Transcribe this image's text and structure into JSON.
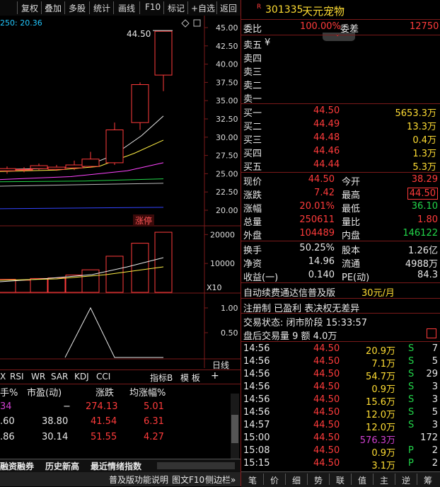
{
  "toolbar": {
    "buttons": [
      "复权",
      "叠加",
      "多股",
      "统计",
      "画线",
      "F10",
      "标记",
      "+自选",
      "返回"
    ]
  },
  "chart": {
    "ma_readout": "250: 20.36",
    "peak_label": "44.50",
    "yaxis_price": [
      "45.00",
      "42.50",
      "40.00",
      "37.50",
      "35.00",
      "32.50",
      "30.00",
      "27.50",
      "25.00",
      "22.50",
      "20.00"
    ],
    "badge": "涨停",
    "yaxis_volume": [
      "20000",
      "10000"
    ],
    "volume_unit": "X10",
    "yaxis_indicator": [
      "1.00",
      "0.50"
    ],
    "indicator_label": "日线",
    "indicator_tabs": [
      "X",
      "RSI",
      "WR",
      "SAR",
      "KDJ",
      "CCI"
    ],
    "indicator_menu": [
      "指标B",
      "模 板"
    ],
    "plus": "+",
    "candles": [
      {
        "o": 25.4,
        "c": 25.7,
        "h": 26.0,
        "l": 25.0
      },
      {
        "o": 25.6,
        "c": 25.5,
        "h": 25.9,
        "l": 25.2
      },
      {
        "o": 25.7,
        "c": 26.1,
        "h": 26.4,
        "l": 25.5
      },
      {
        "o": 25.9,
        "c": 25.6,
        "h": 26.2,
        "l": 25.4
      },
      {
        "o": 25.8,
        "c": 26.2,
        "h": 26.8,
        "l": 25.5
      },
      {
        "o": 26.0,
        "c": 27.0,
        "h": 28.0,
        "l": 25.8
      },
      {
        "o": 26.5,
        "c": 31.0,
        "h": 32.0,
        "l": 26.2
      },
      {
        "o": 32.0,
        "c": 37.2,
        "h": 37.5,
        "l": 31.0
      },
      {
        "o": 38.5,
        "c": 44.5,
        "h": 44.5,
        "l": 36.3
      }
    ],
    "volumes": [
      4500,
      4200,
      4800,
      5000,
      6000,
      7800,
      12500,
      17000,
      20800,
      23500
    ],
    "indicator_values": [
      0,
      0,
      0,
      0,
      0,
      1,
      0,
      0,
      0
    ]
  },
  "table": {
    "headers": [
      "手%",
      "市盈(动)",
      "涨跌",
      "均涨幅%"
    ],
    "rows": [
      [
        "34",
        "−",
        "274.13",
        "5.01"
      ],
      [
        ".60",
        "38.80",
        "41.54",
        "6.31"
      ],
      [
        ".86",
        "30.14",
        "51.55",
        "4.27"
      ]
    ],
    "bottom_tabs": [
      "融资融券",
      "历史新高",
      "最近情绪指数"
    ],
    "bottom_links": [
      "普及版功能说明",
      "图文F10",
      "侧边栏»"
    ]
  },
  "quote": {
    "code": "301335",
    "name": "天元宠物",
    "r_icon": "R",
    "weibi_label": "委比",
    "weibi": "100.00%",
    "weicha_label": "委差",
    "weicha": "12750",
    "sell": [
      {
        "label": "卖五",
        "extra": "¥"
      },
      {
        "label": "卖四",
        "extra": ""
      },
      {
        "label": "卖三",
        "extra": ""
      },
      {
        "label": "卖二",
        "extra": ""
      },
      {
        "label": "卖一",
        "extra": ""
      }
    ],
    "buy": [
      {
        "label": "买一",
        "price": "44.50",
        "vol": "5653.3万"
      },
      {
        "label": "买二",
        "price": "44.49",
        "vol": "13.3万"
      },
      {
        "label": "买三",
        "price": "44.48",
        "vol": "0.4万"
      },
      {
        "label": "买四",
        "price": "44.46",
        "vol": "1.3万"
      },
      {
        "label": "买五",
        "price": "44.44",
        "vol": "5.3万"
      }
    ],
    "stats": [
      {
        "l1": "现价",
        "v1": "44.50",
        "l2": "今开",
        "v2": "38.29",
        "c2": "red"
      },
      {
        "l1": "涨跌",
        "v1": "7.42",
        "l2": "最高",
        "v2": "44.50",
        "c2": "red"
      },
      {
        "l1": "涨幅",
        "v1": "20.01%",
        "l2": "最低",
        "v2": "36.10",
        "c2": "green"
      },
      {
        "l1": "总量",
        "v1": "250611",
        "l2": "量比",
        "v2": "1.80",
        "c2": "red"
      },
      {
        "l1": "外盘",
        "v1": "104489",
        "l2": "内盘",
        "v2": "146122",
        "c2": "green"
      }
    ],
    "stats2": [
      {
        "l1": "换手",
        "v1": "50.25%",
        "l2": "股本",
        "v2": "1.26亿"
      },
      {
        "l1": "净资",
        "v1": "14.96",
        "l2": "流通",
        "v2": "4988万"
      },
      {
        "l1": "收益(一)",
        "v1": "0.140",
        "l2": "PE(动)",
        "v2": "84.3"
      }
    ],
    "promo": "自动续费通达信普及版",
    "promo_price": "30元/月",
    "reg_info": "注册制 已盈利 表决权无差异",
    "trade_status": "交易状态: 闭市阶段 15:33:57",
    "after_hours": "盘后交易量 9 额 4.0万",
    "ticks": [
      {
        "t": "14:56",
        "p": "44.50",
        "v": "20.9万",
        "s": "S",
        "n": "7"
      },
      {
        "t": "14:56",
        "p": "44.50",
        "v": "7.1万",
        "s": "S",
        "n": "5"
      },
      {
        "t": "14:56",
        "p": "44.50",
        "v": "54.7万",
        "s": "S",
        "n": "29"
      },
      {
        "t": "14:56",
        "p": "44.50",
        "v": "0.9万",
        "s": "S",
        "n": "3"
      },
      {
        "t": "14:56",
        "p": "44.50",
        "v": "15.6万",
        "s": "S",
        "n": "3"
      },
      {
        "t": "14:56",
        "p": "44.50",
        "v": "12.0万",
        "s": "S",
        "n": "5"
      },
      {
        "t": "14:57",
        "p": "44.50",
        "v": "12.0万",
        "s": "S",
        "n": "3"
      },
      {
        "t": "15:00",
        "p": "44.50",
        "v": "576.3万",
        "s": "",
        "n": "172"
      },
      {
        "t": "15:08",
        "p": "44.50",
        "v": "0.9万",
        "s": "P",
        "n": "2"
      },
      {
        "t": "15:15",
        "p": "44.50",
        "v": "3.1万",
        "s": "P",
        "n": "2"
      }
    ],
    "bottom_tabs": [
      "笔",
      "价",
      "细",
      "势",
      "联",
      "值",
      "主",
      "逆",
      "筹"
    ]
  }
}
